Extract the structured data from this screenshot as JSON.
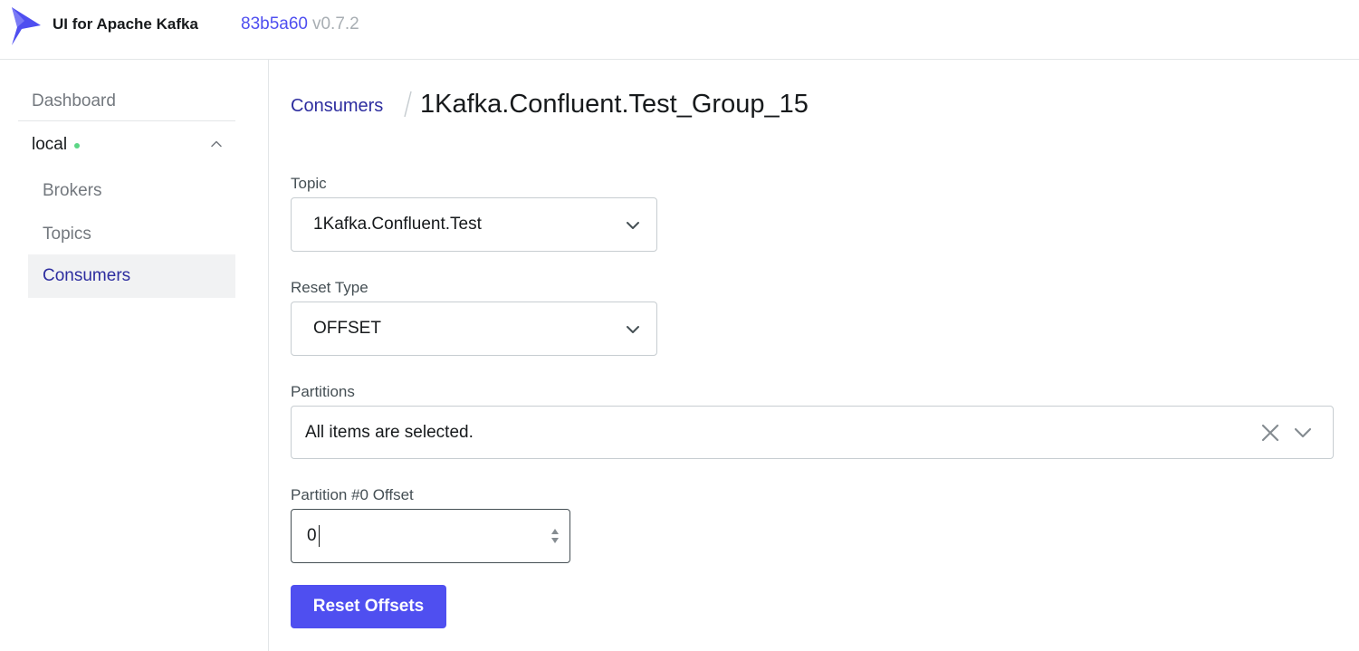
{
  "header": {
    "app_title": "UI for Apache Kafka",
    "commit_hash": "83b5a60",
    "version": "v0.7.2"
  },
  "sidebar": {
    "dashboard_label": "Dashboard",
    "cluster": {
      "name": "local",
      "status": "online",
      "expanded": true
    },
    "items": [
      {
        "label": "Brokers",
        "active": false
      },
      {
        "label": "Topics",
        "active": false
      },
      {
        "label": "Consumers",
        "active": true
      }
    ]
  },
  "breadcrumb": {
    "parent": "Consumers",
    "separator": "/",
    "current": "1Kafka.Confluent.Test_Group_15"
  },
  "form": {
    "topic": {
      "label": "Topic",
      "value": "1Kafka.Confluent.Test"
    },
    "reset_type": {
      "label": "Reset Type",
      "value": "OFFSET"
    },
    "partitions": {
      "label": "Partitions",
      "value": "All items are selected."
    },
    "partition_offset": {
      "label": "Partition #0 Offset",
      "value": "0"
    },
    "submit_label": "Reset Offsets"
  },
  "colors": {
    "accent": "#4f4ff0",
    "link": "#2d2d9f",
    "status_online": "#5cd685",
    "muted_text": "#73787e",
    "border": "#c7cdd1"
  },
  "icons": {
    "logo": "kafka-bird-logo",
    "dropdown": "chevron-down-icon",
    "collapse": "chevron-up-icon",
    "clear": "close-icon",
    "spinner": "stepper-arrows-icon"
  }
}
